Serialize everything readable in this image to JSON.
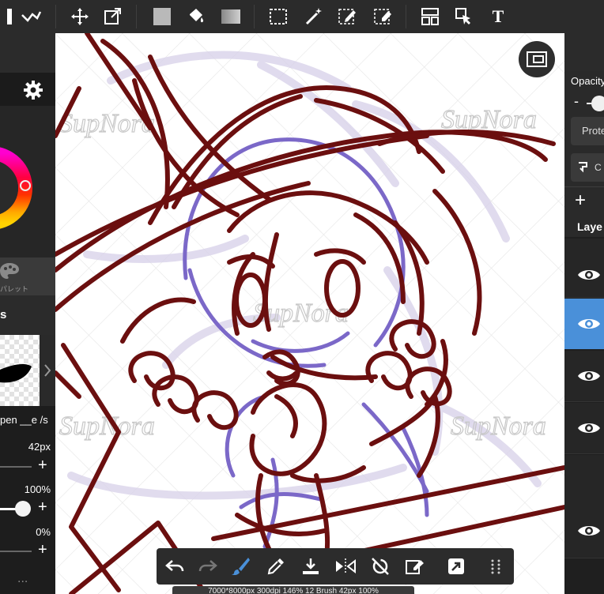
{
  "toolbar": {
    "text_tool_label": "T"
  },
  "left_panel": {
    "palette_label": "パレット",
    "brush_section_label": "s",
    "brush_name": "pen __e /s",
    "brush_size": "42px",
    "brush_opacity": "100%",
    "brush_blur": "0%",
    "plus": "+",
    "more": "..."
  },
  "right_panel": {
    "opacity_label": "Opacity",
    "minus": "-",
    "protect_label": "Prote",
    "clip_label": "C",
    "add_layer": "+",
    "layers_label": "Laye"
  },
  "status_bar": {
    "text": "7000*8000px 300dpi 146%  12 Brush 42px 100%"
  },
  "colors": {
    "accent": "#4a90d9",
    "ink": "#6b0f0f",
    "sketch": "#7b68c8"
  }
}
